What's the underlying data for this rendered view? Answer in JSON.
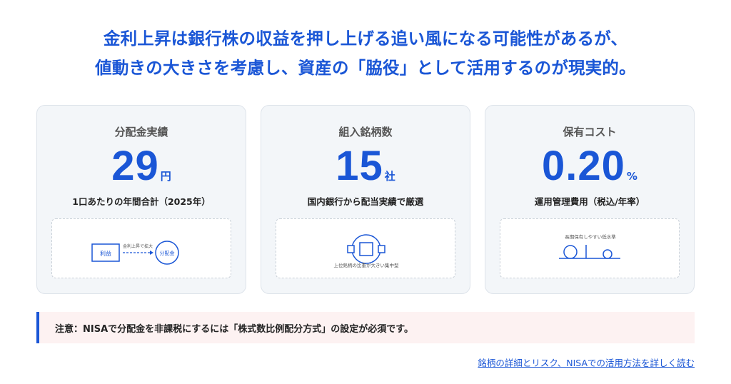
{
  "headline": {
    "line1": "金利上昇は銀行株の収益を押し上げる追い風になる可能性があるが、",
    "line2": "値動きの大きさを考慮し、資産の「脇役」として活用するのが現実的。"
  },
  "cards": [
    {
      "title": "分配金実績",
      "value": "29",
      "unit": "円",
      "description": "1口あたりの年間合計（2025年）",
      "illustration": {
        "box_label": "利益",
        "arrow_label": "金利上昇で拡大",
        "circle_label": "分配金"
      }
    },
    {
      "title": "組入銘柄数",
      "value": "15",
      "unit": "社",
      "description": "国内銀行から配当実績で厳選",
      "illustration": {
        "caption": "上位銘柄の比重が大きい集中型"
      }
    },
    {
      "title": "保有コスト",
      "value": "0.20",
      "unit": "%",
      "description": "運用管理費用（税込/年率）",
      "illustration": {
        "caption": "長期保有しやすい低水準"
      }
    }
  ],
  "notice": {
    "text": "注意：NISAで分配金を非課税にするには「株式数比例配分方式」の設定が必須です。"
  },
  "link": {
    "text": "銘柄の詳細とリスク、NISAでの活用方法を詳しく読む"
  },
  "colors": {
    "accent": "#1a56d6",
    "card_bg": "#f3f6f9",
    "notice_bg": "#fdf2f2"
  }
}
